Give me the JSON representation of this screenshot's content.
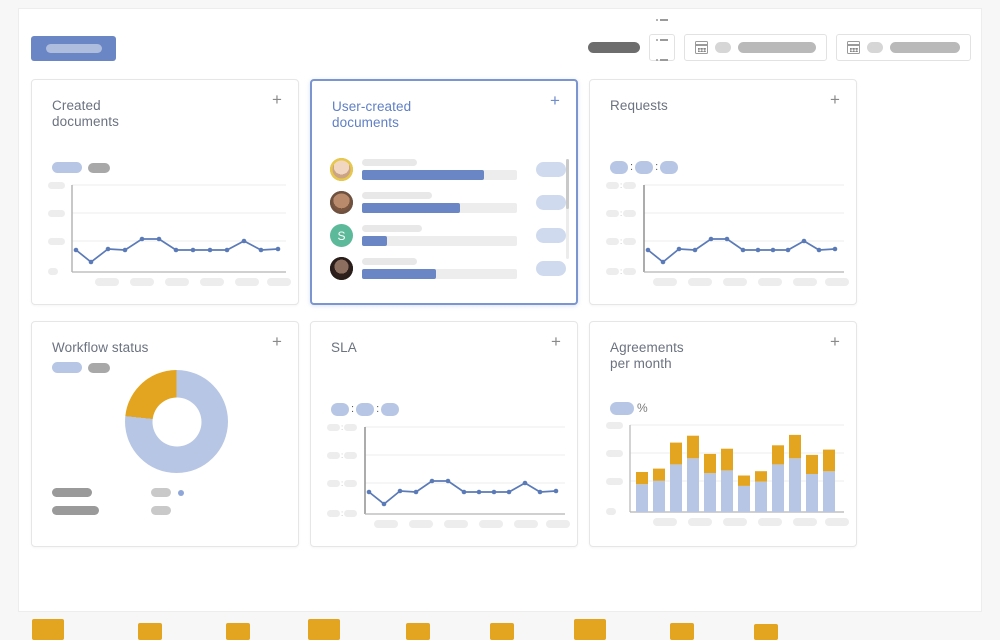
{
  "app": {
    "background_color": "#f7f7f7",
    "canvas_color": "#ffffff",
    "accent_color": "#6a86c4",
    "accent_light": "#b7c6e4",
    "orange_color": "#e3a520"
  },
  "toolbar": {
    "primary_button": {
      "name": "primary-action-button",
      "label_redacted": true
    },
    "title_pill_redacted": true,
    "list_view_button": {
      "icon": "list-icon",
      "label_redacted": true
    },
    "date_range_start": {
      "icon": "calendar-icon",
      "label_redacted": true
    },
    "date_range_end": {
      "icon": "calendar-icon",
      "label_redacted": true
    }
  },
  "cards": [
    {
      "id": "created-documents",
      "title": "Created\ndocuments",
      "selected": false,
      "add_label": "+",
      "type": "line",
      "legend": {
        "style": "pill-pair"
      }
    },
    {
      "id": "user-created-documents",
      "title": "User-created\ndocuments",
      "selected": true,
      "add_label": "+",
      "type": "user-list",
      "rows": [
        {
          "avatar_type": "photo",
          "avatar_ring": "#e8c84a",
          "avatar_color": "#c9a87c",
          "initial": "",
          "progress": 0.79,
          "value_redacted": true
        },
        {
          "avatar_type": "photo",
          "avatar_ring": "#8a6a52",
          "avatar_color": "#8a6a52",
          "initial": "",
          "progress": 0.63,
          "value_redacted": true
        },
        {
          "avatar_type": "initial",
          "avatar_ring": "",
          "avatar_color": "#5cb99a",
          "initial": "S",
          "progress": 0.16,
          "value_redacted": true
        },
        {
          "avatar_type": "photo",
          "avatar_ring": "#3b2a26",
          "avatar_color": "#3b2a26",
          "initial": "",
          "progress": 0.48,
          "value_redacted": true
        }
      ]
    },
    {
      "id": "requests",
      "title": "Requests",
      "selected": false,
      "add_label": "+",
      "type": "line",
      "legend": {
        "style": "colon-pills",
        "separator": ":"
      }
    },
    {
      "id": "workflow-status",
      "title": "Workflow status",
      "selected": false,
      "add_label": "+",
      "type": "donut",
      "legend": {
        "style": "pill-pair"
      }
    },
    {
      "id": "sla",
      "title": "SLA",
      "selected": false,
      "add_label": "+",
      "type": "line",
      "legend": {
        "style": "colon-pills",
        "separator": ":"
      }
    },
    {
      "id": "agreements-per-month",
      "title": "Agreements\nper month",
      "selected": false,
      "add_label": "+",
      "type": "stacked-bar",
      "legend": {
        "style": "percent-pill",
        "unit": "%"
      }
    }
  ],
  "chart_data": [
    {
      "id": "created-documents",
      "type": "line",
      "title": "Created documents",
      "xlabel": "",
      "ylabel": "",
      "categories": [
        "",
        "",
        "",
        "",
        "",
        "",
        "",
        "",
        "",
        "",
        "",
        "",
        ""
      ],
      "values": [
        30,
        14,
        28,
        27,
        37,
        37,
        27,
        27,
        27,
        27,
        35,
        28,
        29
      ],
      "ylim": [
        0,
        100
      ],
      "grid": true,
      "xtick_count": 6,
      "ytick_count": 4,
      "legend_position": "top-left",
      "series_color": "#5a7ab8",
      "tick_labels_redacted": true
    },
    {
      "id": "requests",
      "type": "line",
      "title": "Requests",
      "xlabel": "",
      "ylabel": "",
      "categories": [
        "",
        "",
        "",
        "",
        "",
        "",
        "",
        "",
        "",
        "",
        "",
        "",
        ""
      ],
      "values": [
        30,
        14,
        28,
        27,
        37,
        37,
        27,
        27,
        27,
        27,
        35,
        28,
        29
      ],
      "ylim": [
        0,
        100
      ],
      "grid": true,
      "xtick_count": 6,
      "ytick_count": 4,
      "legend_position": "top-left",
      "series_color": "#5a7ab8",
      "tick_labels_redacted": true
    },
    {
      "id": "sla",
      "type": "line",
      "title": "SLA",
      "xlabel": "",
      "ylabel": "",
      "categories": [
        "",
        "",
        "",
        "",
        "",
        "",
        "",
        "",
        "",
        "",
        "",
        "",
        ""
      ],
      "values": [
        30,
        14,
        28,
        27,
        37,
        37,
        27,
        27,
        27,
        27,
        35,
        28,
        29
      ],
      "ylim": [
        0,
        100
      ],
      "grid": true,
      "xtick_count": 6,
      "ytick_count": 4,
      "legend_position": "top-left",
      "series_color": "#5a7ab8",
      "tick_labels_redacted": true
    },
    {
      "id": "workflow-status",
      "type": "pie",
      "title": "Workflow status",
      "labels": [
        "",
        ""
      ],
      "values": [
        77,
        23
      ],
      "colors": [
        "#b7c6e4",
        "#e3a520"
      ],
      "donut": true,
      "legend_position": "bottom",
      "tick_labels_redacted": true
    },
    {
      "id": "agreements-per-month",
      "type": "bar",
      "stacked": true,
      "title": "Agreements per month",
      "xlabel": "",
      "ylabel": "%",
      "categories": [
        "",
        "",
        "",
        "",
        "",
        "",
        "",
        "",
        "",
        "",
        "",
        ""
      ],
      "series": [
        {
          "name": "",
          "color": "#b7c6e4",
          "values": [
            32,
            36,
            55,
            62,
            45,
            48,
            30,
            35,
            55,
            62,
            44,
            47
          ]
        },
        {
          "name": "",
          "color": "#e3a520",
          "values": [
            14,
            14,
            25,
            26,
            22,
            25,
            12,
            12,
            22,
            27,
            22,
            25
          ]
        }
      ],
      "ylim": [
        0,
        100
      ],
      "grid": true,
      "xtick_count": 6,
      "ytick_count": 4,
      "legend_position": "top-left",
      "tick_labels_redacted": true
    },
    {
      "id": "cut-off-bottom-chart",
      "type": "bar",
      "title": "",
      "categories": [
        "",
        "",
        "",
        "",
        "",
        "",
        "",
        "",
        ""
      ],
      "values": [
        9,
        4,
        5,
        9,
        4,
        5,
        9,
        4,
        4
      ],
      "colors": [
        "#e3a520"
      ],
      "note": "partially visible below viewport fold",
      "tick_labels_redacted": true
    }
  ]
}
